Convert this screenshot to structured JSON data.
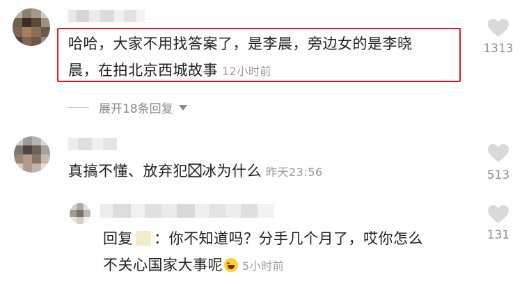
{
  "comments": [
    {
      "text": "哈哈，大家不用找答案了，是李晨，旁边女的是李晓晨，在拍北京西城故事",
      "line1": "哈哈，大家不用找答案了，是李晨，旁边女的是李晓",
      "line2": "晨，在拍北京西城故事",
      "time": "12小时前",
      "likes": "1313",
      "expand": "展开18条回复"
    },
    {
      "text": "真搞不懂、放弃犯冰为什么",
      "line1_a": "真搞不懂、放弃犯",
      "line1_b": "冰为什么",
      "time": "昨天23:56",
      "likes": "513"
    }
  ],
  "reply": {
    "prefix": "回复",
    "line1": "：你不知道吗？分手几个月了，哎你怎么",
    "line2": "不关心国家大事呢",
    "time": "5小时前",
    "likes": "131"
  },
  "colors": {
    "highlight": "#e0181b",
    "muted_text": "#9b9b9b",
    "heart": "#d9d9d9"
  },
  "icons": [
    "heart-icon",
    "chevron-down-icon",
    "laughing-emoji-icon",
    "missing-glyph-icon"
  ]
}
